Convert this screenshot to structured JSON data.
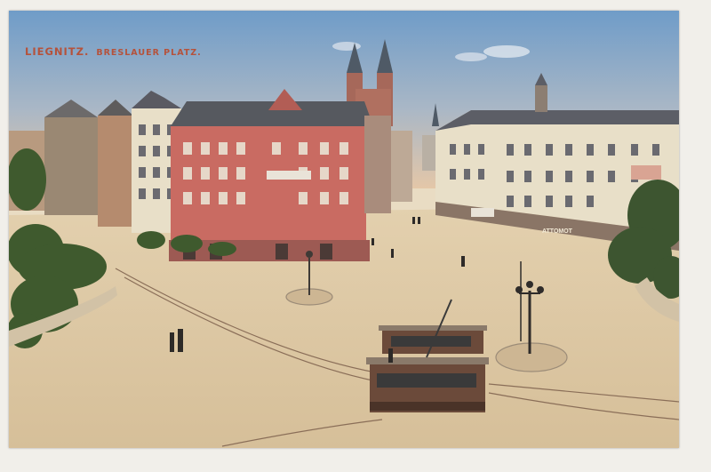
{
  "postcard": {
    "city": "LIEGNITZ.",
    "square": "BRESLAUER PLATZ."
  },
  "palette": {
    "sky_top": "#6f9cc8",
    "sky_horizon": "#e4c7a8",
    "square_ground": "#dcc6a2",
    "red_building": "#c96b62",
    "cream_building": "#e8dfc8",
    "tram": "#6b4a3a",
    "trees": "#3f5a2e"
  },
  "shop_sign": "ATTOMOT"
}
